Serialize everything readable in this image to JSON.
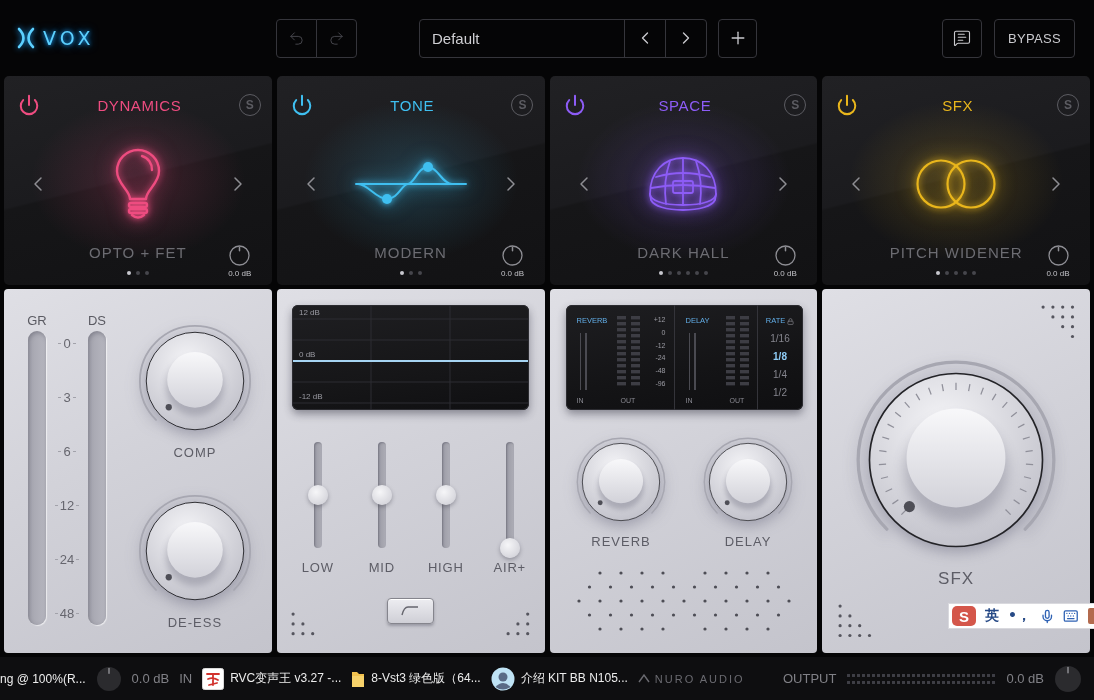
{
  "header": {
    "logo_text": "VOX",
    "undo": {
      "disabled": true
    },
    "redo": {
      "disabled": true
    },
    "preset": {
      "value": "Default"
    },
    "bypass_label": "BYPASS"
  },
  "modules": [
    {
      "kind": "dynamics",
      "title": "DYNAMICS",
      "color": "#ee4c80",
      "enabled": true,
      "solo_label": "S",
      "solo": false,
      "preset": "OPTO + FET",
      "pages": [
        {
          "selected": true
        },
        {
          "selected": false
        },
        {
          "selected": false
        }
      ],
      "gain": "0.0 dB"
    },
    {
      "kind": "tone",
      "title": "TONE",
      "color": "#3fbff0",
      "enabled": true,
      "solo_label": "S",
      "solo": false,
      "preset": "MODERN",
      "pages": [
        {
          "selected": true
        },
        {
          "selected": false
        },
        {
          "selected": false
        }
      ],
      "gain": "0.0 dB"
    },
    {
      "kind": "space",
      "title": "SPACE",
      "color": "#8d5cf6",
      "enabled": true,
      "solo_label": "S",
      "solo": false,
      "preset": "DARK HALL",
      "pages": [
        {
          "selected": true
        },
        {
          "selected": false
        },
        {
          "selected": false
        },
        {
          "selected": false
        },
        {
          "selected": false
        },
        {
          "selected": false
        }
      ],
      "gain": "0.0 dB"
    },
    {
      "kind": "sfx",
      "title": "SFX",
      "color": "#e9b61c",
      "enabled": true,
      "solo_label": "S",
      "solo": false,
      "preset": "PITCH WIDENER",
      "pages": [
        {
          "selected": true
        },
        {
          "selected": false
        },
        {
          "selected": false
        },
        {
          "selected": false
        },
        {
          "selected": false
        }
      ],
      "gain": "0.0 dB"
    }
  ],
  "dynamics_panel": {
    "meters": [
      {
        "label": "GR",
        "level": 0
      },
      {
        "label": "DS",
        "level": 0
      }
    ],
    "scale": [
      "0",
      "3",
      "6",
      "12",
      "24",
      "48"
    ],
    "knobs": [
      {
        "label": "COMP"
      },
      {
        "label": "DE-ESS"
      }
    ]
  },
  "tone_panel": {
    "chart_data": {
      "type": "line",
      "yticks": [
        {
          "value": 12,
          "label": "12 dB"
        },
        {
          "value": 0,
          "label": "0 dB"
        },
        {
          "value": -12,
          "label": "-12 dB"
        }
      ],
      "ylim": [
        -14,
        16
      ],
      "series": [
        {
          "color": "#a6d4f2",
          "values": [
            0,
            0,
            0,
            0,
            0
          ]
        }
      ]
    },
    "sliders": [
      {
        "label": "LOW",
        "level": 0.5
      },
      {
        "label": "MID",
        "level": 0.5
      },
      {
        "label": "HIGH",
        "level": 0.5
      },
      {
        "label": "AIR+",
        "level": 0
      }
    ]
  },
  "space_panel": {
    "sections": [
      {
        "title": "REVERB",
        "meters": [
          {
            "kind": "bar",
            "label": "IN",
            "level": 0
          },
          {
            "kind": "segments",
            "label": "OUT"
          }
        ],
        "scale": [
          "+12",
          "0",
          "-12",
          "-24",
          "-48",
          "-96"
        ]
      },
      {
        "title": "DELAY",
        "meters": [
          {
            "kind": "bar",
            "label": "IN",
            "level": 0
          },
          {
            "kind": "segments",
            "label": "OUT"
          }
        ]
      }
    ],
    "rate": {
      "title": "RATE",
      "locked": true,
      "options": [
        {
          "label": "1/16",
          "selected": false
        },
        {
          "label": "1/8",
          "selected": true
        },
        {
          "label": "1/4",
          "selected": false
        },
        {
          "label": "1/2",
          "selected": false
        }
      ]
    },
    "knobs": [
      {
        "label": "REVERB"
      },
      {
        "label": "DELAY"
      }
    ]
  },
  "sfx_panel": {
    "knob": {
      "label": "SFX"
    }
  },
  "taskbar": [
    {
      "kind": "none",
      "label": "ng @ 100%(R..."
    },
    {
      "kind": "app",
      "label": "RVC变声王 v3.27 -..."
    },
    {
      "kind": "folder",
      "label": "8-Vst3 绿色版（64..."
    },
    {
      "kind": "avatar",
      "label": "介绍 KIT BB N105..."
    }
  ],
  "footer": {
    "input": {
      "value": "0.0 dB",
      "label": "IN"
    },
    "brand": "NURO AUDIO",
    "output": {
      "label": "OUTPUT",
      "meter": {
        "level": 0
      },
      "value": "0.0 dB"
    }
  },
  "ime_toolbar": {
    "logo": "S",
    "mode": "英",
    "punctuation": "•，"
  }
}
